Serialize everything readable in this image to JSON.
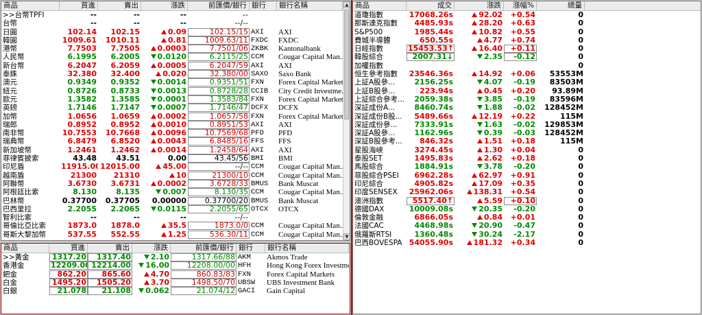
{
  "fx": {
    "headers": [
      "商品",
      "買進",
      "賣出",
      "漲跌",
      "前匯價/銀行",
      "銀行",
      "銀行名稱"
    ],
    "rows": [
      {
        "name": ">>台幣TPFI",
        "bid": "--",
        "ask": "--",
        "chg": "--",
        "prev": "--",
        "code": "",
        "bank": "",
        "dir": "fl"
      },
      {
        "name": "台幣",
        "bid": "--",
        "ask": "--",
        "chg": "--",
        "prev": "--/--",
        "code": "",
        "bank": "",
        "dir": "fl"
      },
      {
        "name": "日圓",
        "bid": "102.14",
        "ask": "102.15",
        "chg": "0.09",
        "prev": "102.15/15",
        "code": "AXI",
        "bank": "AXI",
        "dir": "up"
      },
      {
        "name": "韓圓",
        "bid": "1009.61",
        "ask": "1010.11",
        "chg": "0.81",
        "prev": "1009.63/11",
        "code": "FXDC",
        "bank": "FXDC",
        "dir": "up"
      },
      {
        "name": "港幣",
        "bid": "7.7503",
        "ask": "7.7505",
        "chg": "0.0003",
        "prev": "7.7501/06",
        "code": "ZKBK",
        "bank": "Kantonalbank",
        "dir": "up"
      },
      {
        "name": "人民幣",
        "bid": "6.1995",
        "ask": "6.2005",
        "chg": "0.0120",
        "prev": "6.2115/25",
        "code": "CCM",
        "bank": "Cougar Capital Man...",
        "dir": "dn"
      },
      {
        "name": "新台幣",
        "bid": "6.2047",
        "ask": "6.2059",
        "chg": "0.0005",
        "prev": "6.2047/59",
        "code": "AXI",
        "bank": "AXI",
        "dir": "up"
      },
      {
        "name": "泰銖",
        "bid": "32.380",
        "ask": "32.400",
        "chg": "0.020",
        "prev": "32.380/00",
        "code": "SAXO",
        "bank": "Saxo Bank",
        "dir": "up"
      },
      {
        "name": "澳元",
        "bid": "0.9349",
        "ask": "0.9352",
        "chg": "0.0014",
        "prev": "0.9351/51",
        "code": "FXN",
        "bank": "Forex Capital Markets",
        "dir": "dn"
      },
      {
        "name": "紐元",
        "bid": "0.8726",
        "ask": "0.8733",
        "chg": "0.0013",
        "prev": "0.8728/28",
        "code": "CCIB",
        "bank": "City Credit Investme...",
        "dir": "dn"
      },
      {
        "name": "歐元",
        "bid": "1.3582",
        "ask": "1.3585",
        "chg": "0.0001",
        "prev": "1.3583/84",
        "code": "FXN",
        "bank": "Forex Capital Markets",
        "dir": "dn"
      },
      {
        "name": "英鎊",
        "bid": "1.7146",
        "ask": "1.7147",
        "chg": "0.0007",
        "prev": "1.7146/47",
        "code": "DCFX",
        "bank": "DCFX",
        "dir": "dn"
      },
      {
        "name": "加幣",
        "bid": "1.0656",
        "ask": "1.0659",
        "chg": "0.0002",
        "prev": "1.0657/58",
        "code": "FXN",
        "bank": "Forex Capital Markets",
        "dir": "up"
      },
      {
        "name": "瑞郎",
        "bid": "0.8952",
        "ask": "0.8952",
        "chg": "0.0010",
        "prev": "0.8951/53",
        "code": "AXI",
        "bank": "AXI",
        "dir": "up"
      },
      {
        "name": "南非幣",
        "bid": "10.7553",
        "ask": "10.7668",
        "chg": "0.0096",
        "prev": "10.7569/68",
        "code": "PFD",
        "bank": "PFD",
        "dir": "up"
      },
      {
        "name": "瑞典幣",
        "bid": "6.8479",
        "ask": "6.8520",
        "chg": "0.0043",
        "prev": "6.8485/16",
        "code": "FFS",
        "bank": "FFS",
        "dir": "up"
      },
      {
        "name": "新加坡幣",
        "bid": "1.2461",
        "ask": "1.2462",
        "chg": "0.0014",
        "prev": "1.2458/64",
        "code": "AXI",
        "bank": "AXI",
        "dir": "up"
      },
      {
        "name": "菲律賓披索",
        "bid": "43.48",
        "ask": "43.51",
        "chg": "0.00",
        "prev": "43.45/56",
        "code": "BMI",
        "bank": "BMI",
        "dir": "fl"
      },
      {
        "name": "印尼盾",
        "bid": "11915.00",
        "ask": "12015.00",
        "chg": "45.00",
        "prev": "--/--",
        "code": "CCM",
        "bank": "Cougar Capital Man...",
        "dir": "up"
      },
      {
        "name": "越南盾",
        "bid": "21300",
        "ask": "21310",
        "chg": "10",
        "prev": "21300/10",
        "code": "CCM",
        "bank": "Cougar Capital Man...",
        "dir": "up"
      },
      {
        "name": "阿聯幣",
        "bid": "3.6730",
        "ask": "3.6731",
        "chg": "0.0002",
        "prev": "3.6728/33",
        "code": "BMUS",
        "bank": "Bank Muscat",
        "dir": "up"
      },
      {
        "name": "阿根廷比索",
        "bid": "8.130",
        "ask": "8.135",
        "chg": "0.007",
        "prev": "8.130/35",
        "code": "CCM",
        "bank": "Cougar Capital Man...",
        "dir": "dn"
      },
      {
        "name": "巴林幣",
        "bid": "0.37700",
        "ask": "0.37705",
        "chg": "0.00000",
        "prev": "0.37700/20",
        "code": "BMUS",
        "bank": "Bank Muscat",
        "dir": "fl"
      },
      {
        "name": "巴西里拉",
        "bid": "2.2055",
        "ask": "2.2065",
        "chg": "0.0115",
        "prev": "2.2055/65",
        "code": "OTCX",
        "bank": "OTCX",
        "dir": "dn"
      },
      {
        "name": "智利比索",
        "bid": "--",
        "ask": "--",
        "chg": "--",
        "prev": "--/--",
        "code": "",
        "bank": "",
        "dir": "fl"
      },
      {
        "name": "哥倫比亞比索",
        "bid": "1873.0",
        "ask": "1878.0",
        "chg": "35.5",
        "prev": "1873.0/0",
        "code": "CCM",
        "bank": "Cougar Capital Man...",
        "dir": "up"
      },
      {
        "name": "哥斯大黎加幣",
        "bid": "537.55",
        "ask": "552.55",
        "chg": "1.25",
        "prev": "536.30/11",
        "code": "CCM",
        "bank": "Cougar Capital Man...",
        "dir": "up"
      }
    ]
  },
  "commodities": {
    "headers": [
      "商品",
      "買進",
      "賣出",
      "漲跌",
      "前匯價/銀行",
      "銀行",
      "銀行名稱"
    ],
    "rows": [
      {
        "name": ">>黃金",
        "bid": "1317.20",
        "ask": "1317.40",
        "chg": "2.10",
        "prev": "1317.66/88",
        "code": "AKM",
        "bank": "Akmos Trade",
        "dir": "dn"
      },
      {
        "name": "香港金",
        "bid": "12209.00",
        "ask": "12214.00",
        "chg": "16.00",
        "prev": "12208.00/00",
        "code": "HFH",
        "bank": "Hong Kong Forex Investment",
        "dir": "dn"
      },
      {
        "name": "鈀金",
        "bid": "862.20",
        "ask": "865.60",
        "chg": "4.70",
        "prev": "860.83/83",
        "code": "FXN",
        "bank": "Forex Capital Markets",
        "dir": "up"
      },
      {
        "name": "白金",
        "bid": "1495.20",
        "ask": "1505.20",
        "chg": "3.70",
        "prev": "1498.50/70",
        "code": "UBSW",
        "bank": "UBS Investment Bank",
        "dir": "up"
      },
      {
        "name": "白銀",
        "bid": "21.078",
        "ask": "21.108",
        "chg": "0.062",
        "prev": "21.074/12",
        "code": "GACI",
        "bank": "Gain Capital",
        "dir": "dn"
      }
    ]
  },
  "indices": {
    "headers": [
      "商品",
      "成交",
      "漲跌",
      "漲幅%",
      "總量"
    ],
    "rows": [
      {
        "name": "道瓊指數",
        "last": "17068.26s",
        "chg": "92.02",
        "pct": "+0.54",
        "vol": "0",
        "dir": "up"
      },
      {
        "name": "那斯達克指數",
        "last": "4485.93s",
        "chg": "28.20",
        "pct": "+0.63",
        "vol": "0",
        "dir": "up"
      },
      {
        "name": "S&P500",
        "last": "1985.44s",
        "chg": "10.82",
        "pct": "+0.55",
        "vol": "0",
        "dir": "up"
      },
      {
        "name": "費城半導體",
        "last": "650.55s",
        "chg": "4.77",
        "pct": "+0.74",
        "vol": "0",
        "dir": "up"
      },
      {
        "name": "日經指數",
        "last": "15453.53↑",
        "chg": "16.40",
        "pct": "+0.11",
        "vol": "0",
        "dir": "up"
      },
      {
        "name": "韓股綜合",
        "last": "2007.31↓",
        "chg": "2.35",
        "pct": "-0.12",
        "vol": "0",
        "dir": "dn"
      },
      {
        "name": "加權指數",
        "last": "",
        "chg": "",
        "pct": "",
        "vol": "0",
        "dir": "fl"
      },
      {
        "name": "恒生參考指數",
        "last": "23546.36s",
        "chg": "14.92",
        "pct": "+0.06",
        "vol": "53553M",
        "dir": "up"
      },
      {
        "name": "上証A股參...",
        "last": "2156.25s",
        "chg": "4.07",
        "pct": "-0.19",
        "vol": "83503M",
        "dir": "dn"
      },
      {
        "name": "上証B股參...",
        "last": "223.94s",
        "chg": "0.45",
        "pct": "+0.20",
        "vol": "93.89M",
        "dir": "up"
      },
      {
        "name": "上証綜合參考...",
        "last": "2059.38s",
        "chg": "3.85",
        "pct": "-0.19",
        "vol": "83596M",
        "dir": "dn"
      },
      {
        "name": "深証成份A...",
        "last": "8460.74s",
        "chg": "1.88",
        "pct": "-0.02",
        "vol": "128452M",
        "dir": "dn"
      },
      {
        "name": "深証成份B股...",
        "last": "5489.66s",
        "chg": "12.19",
        "pct": "+0.22",
        "vol": "115M",
        "dir": "up"
      },
      {
        "name": "深証成份參...",
        "last": "7333.91s",
        "chg": "1.63",
        "pct": "-0.02",
        "vol": "129853M",
        "dir": "dn"
      },
      {
        "name": "深証A股參...",
        "last": "1162.96s",
        "chg": "0.39",
        "pct": "-0.03",
        "vol": "128452M",
        "dir": "dn"
      },
      {
        "name": "深証B股參考...",
        "last": "846.32s",
        "chg": "1.51",
        "pct": "+0.18",
        "vol": "115M",
        "dir": "up"
      },
      {
        "name": "星股海峽",
        "last": "3274.45s",
        "chg": "1.30",
        "pct": "+0.04",
        "vol": "0",
        "dir": "up"
      },
      {
        "name": "泰股SET",
        "last": "1495.83s",
        "chg": "2.62",
        "pct": "+0.18",
        "vol": "0",
        "dir": "up"
      },
      {
        "name": "馬股綜合",
        "last": "1884.91s",
        "chg": "3.78",
        "pct": "-0.20",
        "vol": "0",
        "dir": "dn"
      },
      {
        "name": "菲股綜合PSEI",
        "last": "6962.28s",
        "chg": "62.97",
        "pct": "+0.91",
        "vol": "0",
        "dir": "up"
      },
      {
        "name": "印尼綜合",
        "last": "4905.82s",
        "chg": "17.09",
        "pct": "+0.35",
        "vol": "0",
        "dir": "up"
      },
      {
        "name": "印度SENSEX",
        "last": "25962.06s",
        "chg": "138.31",
        "pct": "+0.54",
        "vol": "0",
        "dir": "up"
      },
      {
        "name": "澳洲指數",
        "last": "5517.40↑",
        "chg": "5.59",
        "pct": "+0.10",
        "vol": "0",
        "dir": "up"
      },
      {
        "name": "德國DAX",
        "last": "10009.08s",
        "chg": "20.35",
        "pct": "-0.20",
        "vol": "0",
        "dir": "dn"
      },
      {
        "name": "倫敦金融",
        "last": "6866.05s",
        "chg": "0.84",
        "pct": "+0.01",
        "vol": "0",
        "dir": "up"
      },
      {
        "name": "法國CAC",
        "last": "4468.98s",
        "chg": "20.90",
        "pct": "-0.47",
        "vol": "0",
        "dir": "dn"
      },
      {
        "name": "俄羅斯RTSI",
        "last": "1360.48s",
        "chg": "30.24",
        "pct": "-2.17",
        "vol": "0",
        "dir": "dn"
      },
      {
        "name": "巴西BOVESPA",
        "last": "54055.90s",
        "chg": "181.32",
        "pct": "+0.34",
        "vol": "0",
        "dir": "up"
      }
    ]
  },
  "colors": {
    "up": "#e00000",
    "down": "#008a00",
    "divider": "#c00000"
  }
}
